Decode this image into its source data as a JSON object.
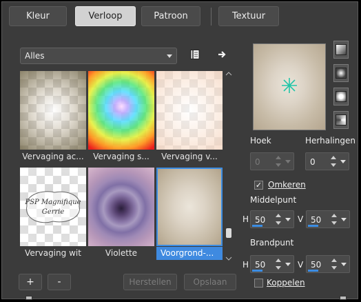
{
  "tabs": [
    {
      "label": "Kleur",
      "active": false
    },
    {
      "label": "Verloop",
      "active": true
    },
    {
      "label": "Patroon",
      "active": false
    },
    {
      "label": "Textuur",
      "active": false
    }
  ],
  "category": {
    "selected": "Alles"
  },
  "icons": {
    "library": "library-book-icon",
    "export": "arrow-right-icon"
  },
  "gradients": [
    {
      "caption": "Vervaging ac...",
      "style": "accent-fade"
    },
    {
      "caption": "Vervaging s...",
      "style": "spectrum-fade"
    },
    {
      "caption": "Vervaging v...",
      "style": "foreground-fade"
    },
    {
      "caption": "Vervaging wit",
      "style": "white-fade",
      "watermark": [
        "PSP Magnifique",
        "Gerrie"
      ]
    },
    {
      "caption": "Violette",
      "style": "violet"
    },
    {
      "caption": "Voorgrond-...",
      "style": "foreground-background",
      "selected": true
    }
  ],
  "buttons": {
    "add": "+",
    "remove": "-",
    "reset": "Herstellen",
    "save": "Opslaan"
  },
  "gradient_types": [
    "linear",
    "rectangular",
    "sunburst",
    "radial"
  ],
  "settings": {
    "angle_label": "Hoek",
    "angle_value": "0",
    "repeats_label": "Herhalingen",
    "repeats_value": "0",
    "invert_label": "Omkeren",
    "invert_checked": true,
    "center_label": "Middelpunt",
    "center_h_label": "H",
    "center_h": "50",
    "center_v_label": "V",
    "center_v": "50",
    "focal_label": "Brandpunt",
    "focal_h_label": "H",
    "focal_h": "50",
    "focal_v_label": "V",
    "focal_v": "50",
    "link_label": "Koppelen",
    "link_checked": false
  },
  "colors": {
    "accent": "#3c8de3",
    "foreground": "#e9e2d6",
    "background": "#b4a58e"
  }
}
